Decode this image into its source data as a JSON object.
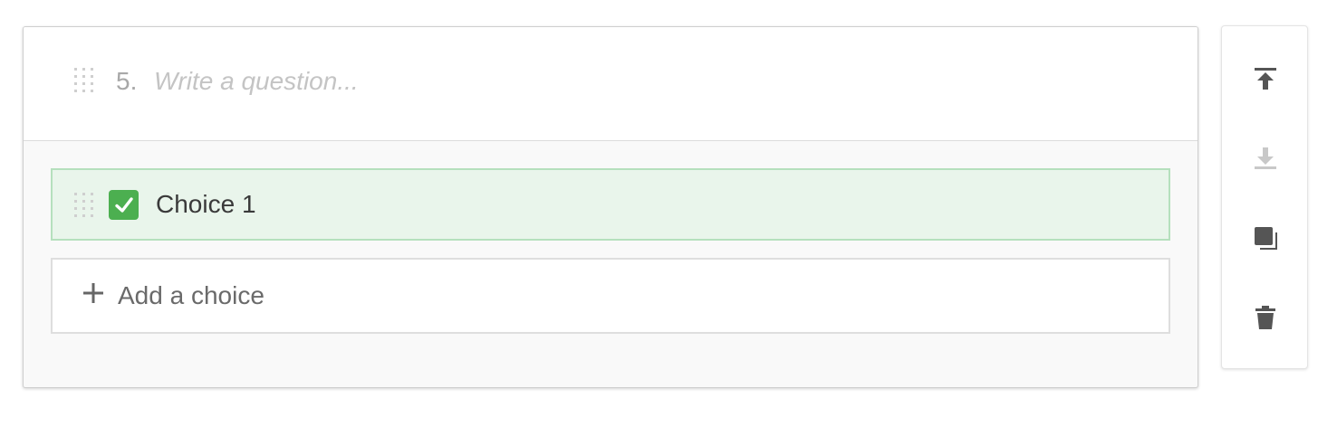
{
  "question": {
    "number": "5.",
    "placeholder": "Write a question...",
    "value": ""
  },
  "choices": [
    {
      "label": "Choice 1",
      "checked": true
    }
  ],
  "add_choice": {
    "label": "Add a choice",
    "icon": "plus-icon"
  },
  "toolbar": [
    {
      "name": "move-to-top",
      "icon": "arrow-up-to-line-icon",
      "enabled": true
    },
    {
      "name": "move-to-bottom",
      "icon": "arrow-down-to-line-icon",
      "enabled": false
    },
    {
      "name": "duplicate",
      "icon": "copy-icon",
      "enabled": true
    },
    {
      "name": "delete",
      "icon": "trash-icon",
      "enabled": true
    }
  ],
  "colors": {
    "accent_green": "#4caf50",
    "choice_bg": "#e9f5eb",
    "choice_border": "#b5e0bd",
    "icon_active": "#555555",
    "icon_disabled": "#c8c8c8"
  }
}
